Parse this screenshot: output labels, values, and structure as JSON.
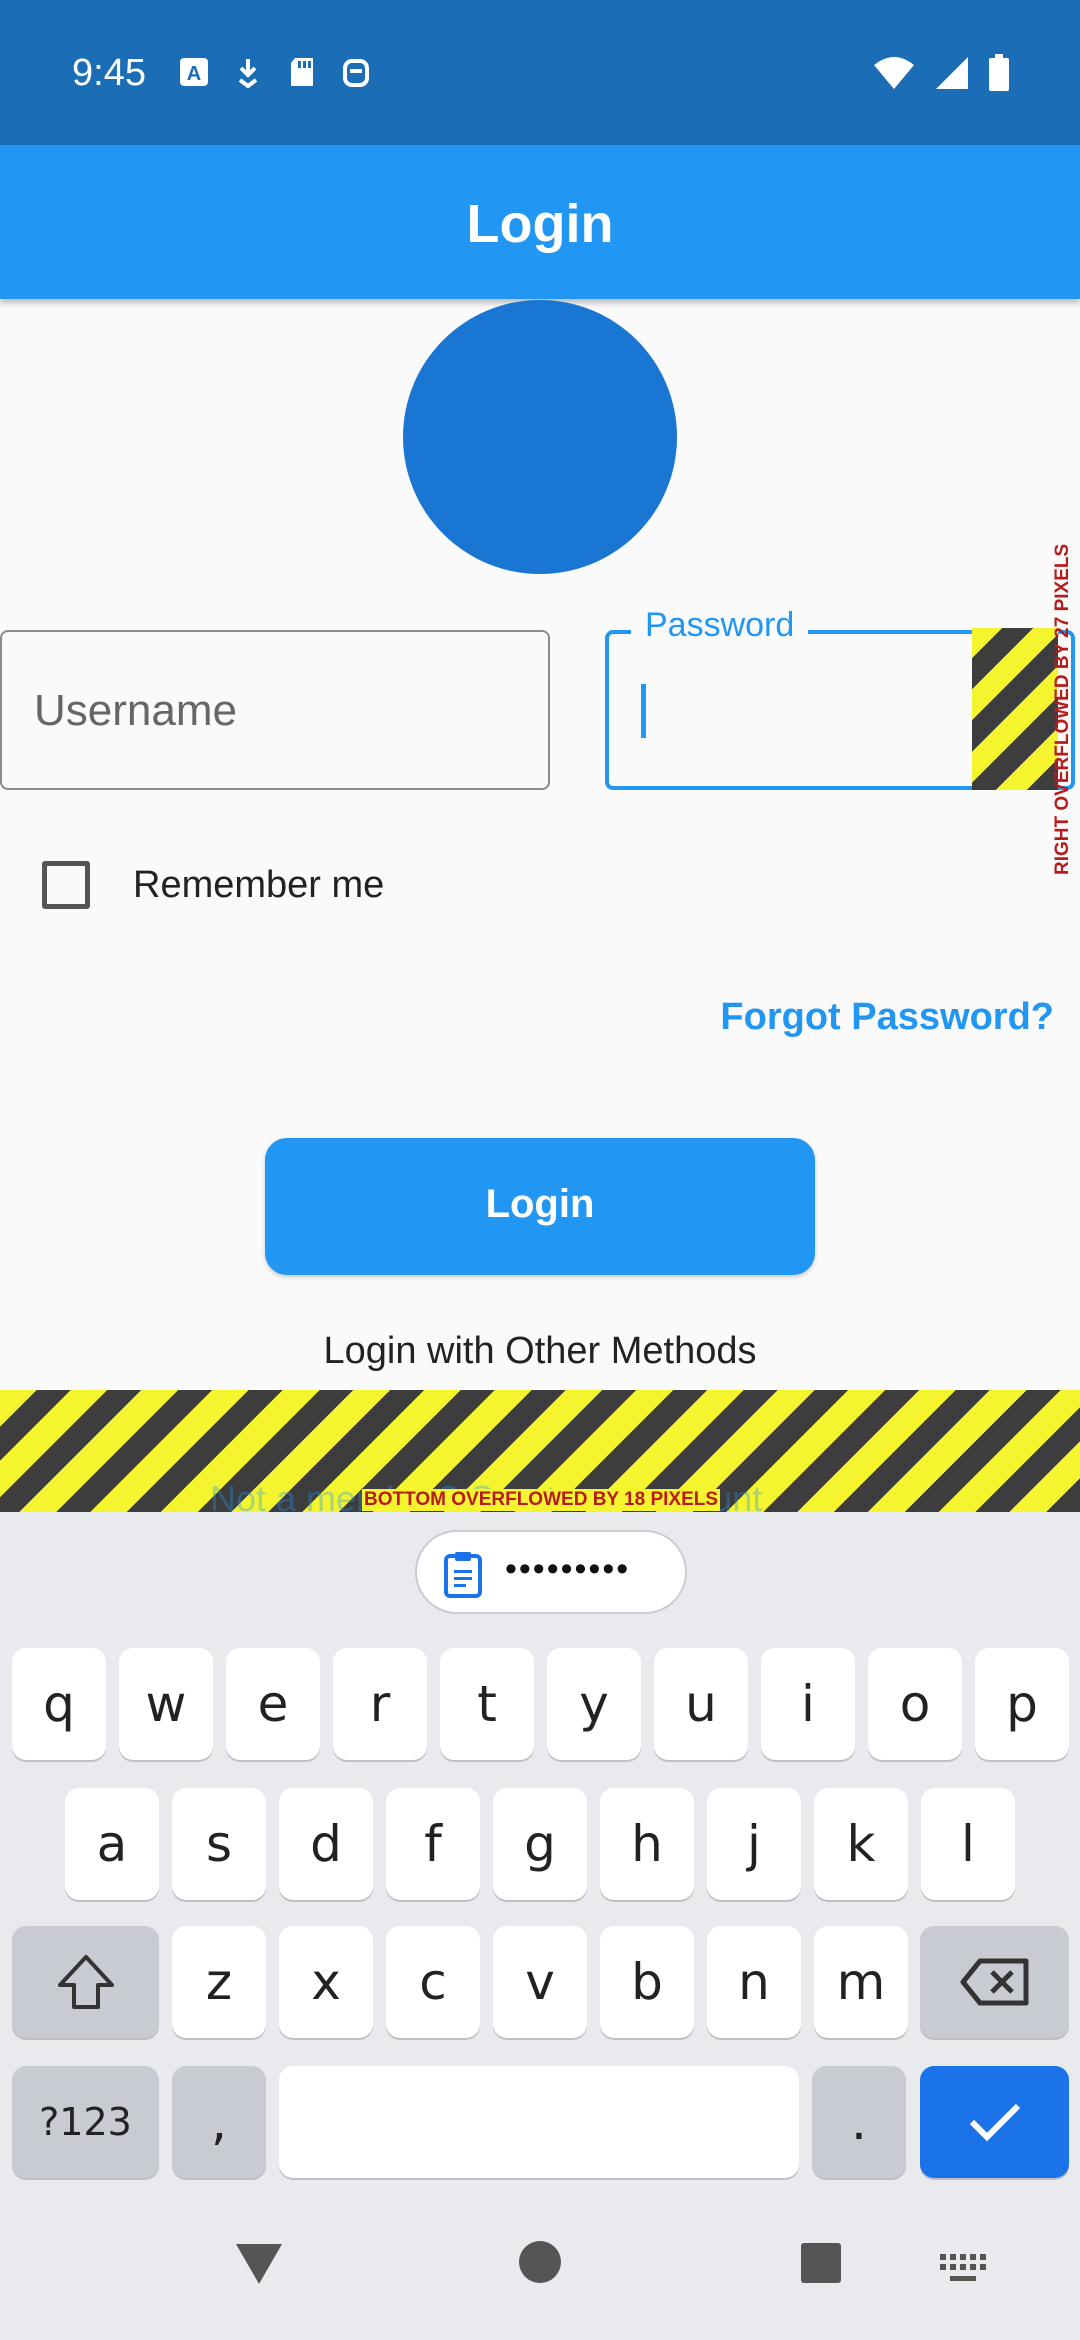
{
  "status_bar": {
    "time": "9:45",
    "left_icons": [
      "a-icon",
      "download-icon",
      "sd-card-icon",
      "robot-icon"
    ],
    "right_icons": [
      "wifi-icon",
      "signal-icon",
      "battery-icon"
    ]
  },
  "app_bar": {
    "title": "Login"
  },
  "form": {
    "username_placeholder": "Username",
    "password_label": "Password",
    "remember_label": "Remember me",
    "remember_checked": false,
    "forgot_label": "Forgot Password?",
    "login_button_label": "Login",
    "other_methods_label": "Login with Other Methods",
    "signup_text": "Not a member? Create an account"
  },
  "debug": {
    "right_overflow_label": "RIGHT OVERFLOWED BY 27 PIXELS",
    "bottom_overflow_label": "BOTTOM OVERFLOWED BY 18 PIXELS"
  },
  "keyboard": {
    "suggestion": "•••••••••",
    "rows": [
      [
        "q",
        "w",
        "e",
        "r",
        "t",
        "y",
        "u",
        "i",
        "o",
        "p"
      ],
      [
        "a",
        "s",
        "d",
        "f",
        "g",
        "h",
        "j",
        "k",
        "l"
      ],
      [
        "z",
        "x",
        "c",
        "v",
        "b",
        "n",
        "m"
      ]
    ],
    "symbols_key": "?123",
    "comma_key": ",",
    "period_key": "."
  },
  "colors": {
    "primary": "#2196f3",
    "status_bar": "#1b6db5",
    "avatar": "#1976d2",
    "keyboard_action": "#1a73e8",
    "overflow_text": "#b71c1c"
  }
}
